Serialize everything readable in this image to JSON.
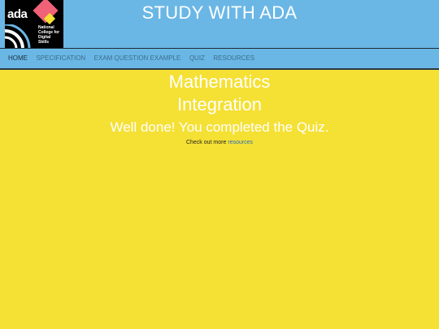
{
  "logo": {
    "word": "ada",
    "tagline": "National\nCollege for\nDigital\nSkills"
  },
  "header": {
    "title": "STUDY WITH ADA"
  },
  "nav": {
    "items": [
      {
        "label": "HOME",
        "active": true
      },
      {
        "label": "SPECIFICATION",
        "active": false
      },
      {
        "label": "EXAM QUESTION EXAMPLE",
        "active": false
      },
      {
        "label": "QUIZ",
        "active": false
      },
      {
        "label": "RESOURCES",
        "active": false
      }
    ]
  },
  "main": {
    "subject": "Mathematics",
    "topic": "Integration",
    "message": "Well done! You completed the Quiz.",
    "more_prefix": "Check out more ",
    "more_link": "resources"
  },
  "colors": {
    "header_bg": "#6ab7e6",
    "page_bg": "#f5e034",
    "logo_pink": "#f06277"
  }
}
